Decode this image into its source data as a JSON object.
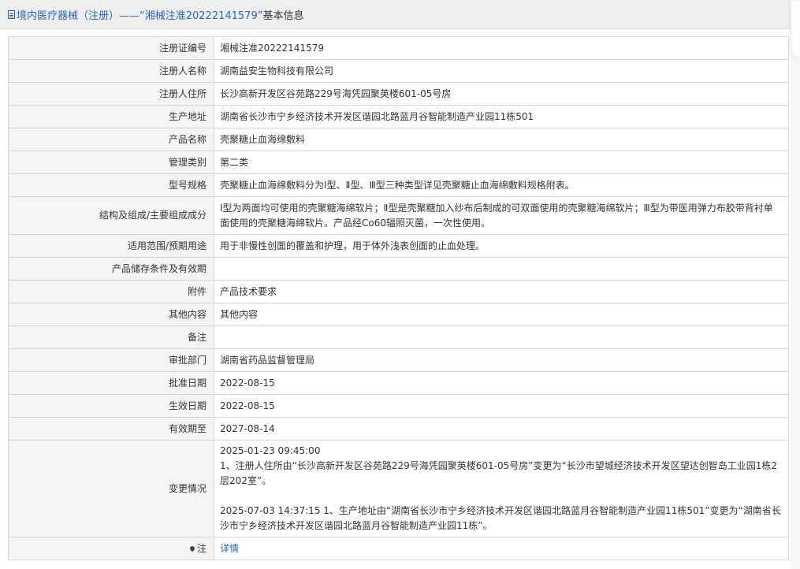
{
  "header": {
    "title": "境内医疗器械（注册）——“湘械注准20222141579”",
    "title_suffix": "基本信息",
    "icon": "document-icon"
  },
  "rows": [
    {
      "label": "注册证编号",
      "value": "湘械注准20222141579"
    },
    {
      "label": "注册人名称",
      "value": "湖南益安生物科技有限公司"
    },
    {
      "label": "注册人住所",
      "value": "长沙高新开发区谷苑路229号海凭园聚英楼601-05号房"
    },
    {
      "label": "生产地址",
      "value": "湖南省长沙市宁乡经济技术开发区谐园北路蓝月谷智能制造产业园11栋501"
    },
    {
      "label": "产品名称",
      "value": "壳聚糖止血海绵敷料"
    },
    {
      "label": "管理类别",
      "value": "第二类"
    },
    {
      "label": "型号规格",
      "value": "壳聚糖止血海绵敷料分为Ⅰ型、Ⅱ型、Ⅲ型三种类型详见壳聚糖止血海绵敷料规格附表。"
    },
    {
      "label": "结构及组成/主要组成成分",
      "value": "Ⅰ型为两面均可使用的壳聚糖海绵软片；Ⅱ型是壳聚糖加入纱布后制成的可双面使用的壳聚糖海绵软片；Ⅲ型为带医用弹力布胶带背衬单面使用的壳聚糖海绵软片。产品经Co60辐照灭菌，一次性使用。"
    },
    {
      "label": "适用范围/预期用途",
      "value": "用于非慢性创面的覆盖和护理，用于体外浅表创面的止血处理。"
    },
    {
      "label": "产品储存条件及有效期",
      "value": ""
    },
    {
      "label": "附件",
      "value": "产品技术要求"
    },
    {
      "label": "其他内容",
      "value": "其他内容"
    },
    {
      "label": "备注",
      "value": ""
    },
    {
      "label": "审批部门",
      "value": "湖南省药品监督管理局"
    },
    {
      "label": "批准日期",
      "value": "2022-08-15"
    },
    {
      "label": "生效日期",
      "value": "2022-08-15"
    },
    {
      "label": "有效期至",
      "value": "2027-08-14"
    }
  ],
  "changes": {
    "label": "变更情况",
    "entries": [
      "2025-01-23 09:45:00",
      "1、注册人住所由“长沙高新开发区谷苑路229号海凭园聚英楼601-05号房”变更为“长沙市望城经济技术开发区望达创智岛工业园1栋2层202室”。",
      "2025-07-03 14:37:15 1、生产地址由“湖南省长沙市宁乡经济技术开发区谐园北路蓝月谷智能制造产业园11栋501”变更为“湖南省长沙市宁乡经济技术开发区谐园北路蓝月谷智能制造产业园11栋”。"
    ]
  },
  "note_row": {
    "label": "注",
    "icon": "pin-icon",
    "link": "详情"
  },
  "colors": {
    "accent": "#2a64b8",
    "label_bg": "#f5f5f5",
    "border": "#d6d6d6"
  }
}
